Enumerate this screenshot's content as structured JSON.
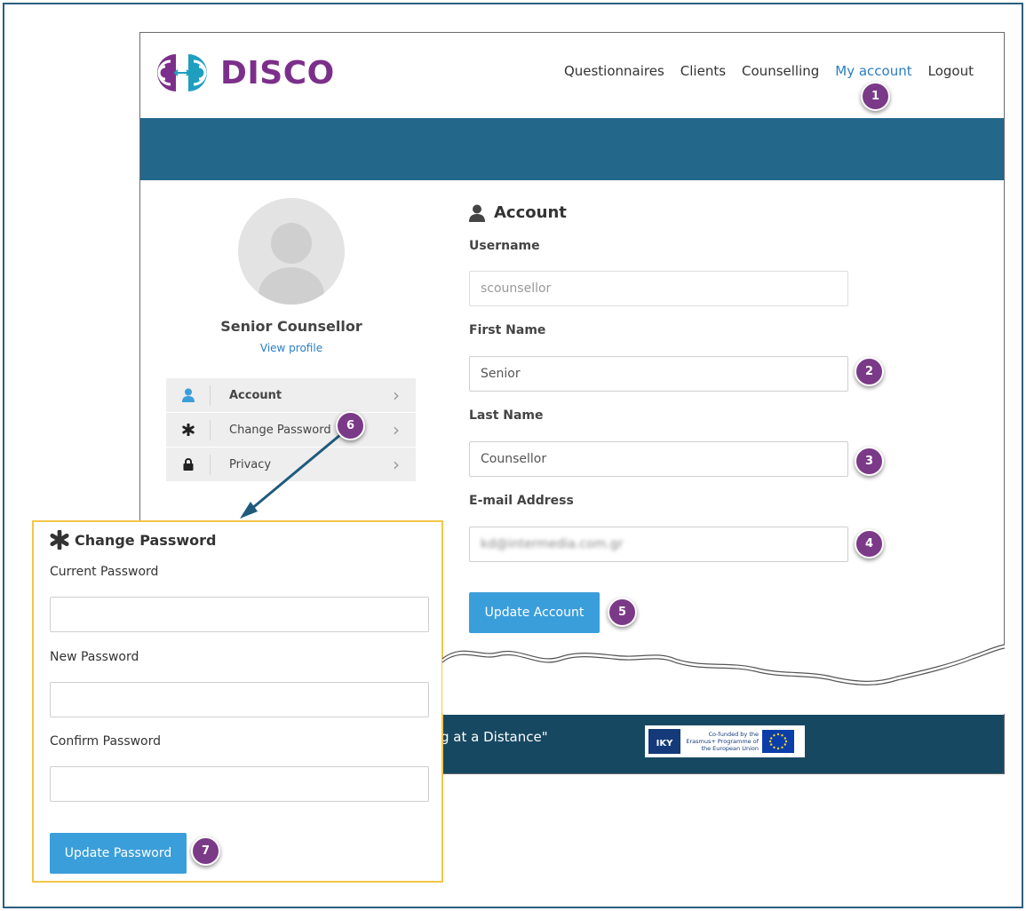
{
  "header": {
    "logo_text": "DISCO",
    "nav": [
      "Questionnaires",
      "Clients",
      "Counselling",
      "My account",
      "Logout"
    ],
    "active_nav": "My account"
  },
  "profile": {
    "name": "Senior Counsellor",
    "link": "View profile"
  },
  "side_menu": [
    {
      "label": "Account",
      "icon": "user-icon"
    },
    {
      "label": "Change Password",
      "icon": "asterisk-icon"
    },
    {
      "label": "Privacy",
      "icon": "lock-icon"
    }
  ],
  "account_form": {
    "title": "Account",
    "username_label": "Username",
    "username_value": "scounsellor",
    "first_name_label": "First Name",
    "first_name_value": "Senior",
    "last_name_label": "Last Name",
    "last_name_value": "Counsellor",
    "email_label": "E-mail Address",
    "email_value": "kd@intermedia.com.gr",
    "submit_label": "Update Account"
  },
  "footer": {
    "text": "lling at a Distance\"",
    "iky_text": "IKY",
    "eu_text": "Co-funded by the Erasmus+ Programme of the European Union"
  },
  "password_form": {
    "title": "Change Password",
    "current_label": "Current Password",
    "new_label": "New Password",
    "confirm_label": "Confirm Password",
    "submit_label": "Update Password"
  },
  "badges": [
    "1",
    "2",
    "3",
    "4",
    "5",
    "6",
    "7"
  ],
  "colors": {
    "brand_purple": "#7c2f8a",
    "brand_teal": "#1f9fc0",
    "banner": "#23678a",
    "footer": "#174861",
    "button": "#3a9edb",
    "badge": "#7b3a87",
    "highlight_border": "#f2c64a"
  }
}
